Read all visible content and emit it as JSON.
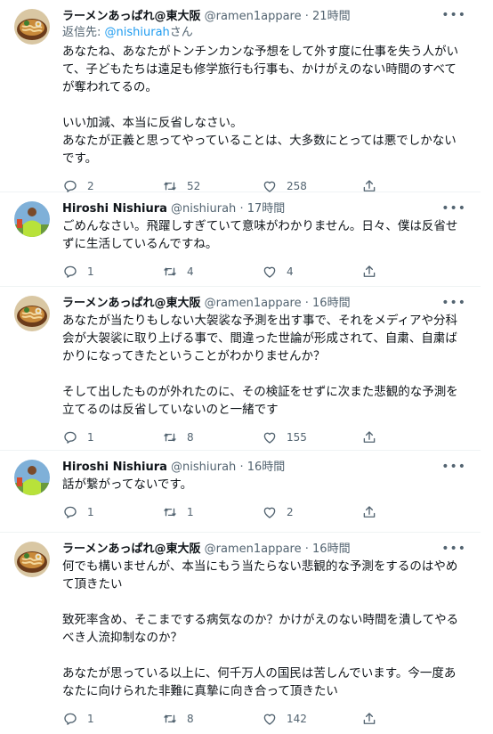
{
  "tweets": [
    {
      "name": "ラーメンあっぱれ@東大阪",
      "handle": "@ramen1appare",
      "time": "21時間",
      "reply_prefix": "返信先: ",
      "reply_handle": "@nishiurah",
      "reply_suffix": "さん",
      "text": "あなたね、あなたがトンチンカンな予想をして外す度に仕事を失う人がいて、子どもたちは遠足も修学旅行も行事も、かけがえのない時間のすべてが奪われてるの。\n\nいい加減、本当に反省しなさい。\nあなたが正義と思ってやっていることは、大多数にとっては悪でしかないです。",
      "replies": "2",
      "retweets": "52",
      "likes": "258"
    },
    {
      "name": "Hiroshi Nishiura",
      "handle": "@nishiurah",
      "time": "17時間",
      "text": "ごめんなさい。飛躍しすぎていて意味がわかりません。日々、僕は反省せずに生活しているんですね。",
      "replies": "1",
      "retweets": "4",
      "likes": "4"
    },
    {
      "name": "ラーメンあっぱれ@東大阪",
      "handle": "@ramen1appare",
      "time": "16時間",
      "text": "あなたが当たりもしない大袈裟な予測を出す事で、それをメディアや分科会が大袈裟に取り上げる事で、間違った世論が形成されて、自粛、自粛ばかりになってきたということがわかりませんか？\n\nそして出したものが外れたのに、その検証をせずに次また悲観的な予測を立てるのは反省していないのと一緒です",
      "replies": "1",
      "retweets": "8",
      "likes": "155"
    },
    {
      "name": "Hiroshi Nishiura",
      "handle": "@nishiurah",
      "time": "16時間",
      "text": "話が繋がってないです。",
      "replies": "1",
      "retweets": "1",
      "likes": "2"
    },
    {
      "name": "ラーメンあっぱれ@東大阪",
      "handle": "@ramen1appare",
      "time": "16時間",
      "text": "何でも構いませんが、本当にもう当たらない悲観的な予測をするのはやめて頂きたい\n\n致死率含め、そこまでする病気なのか？かけがえのない時間を潰してやるべき人流抑制なのか？\n\nあなたが思っている以上に、何千万人の国民は苦しんでいます。今一度あなたに向けられた非難に真摯に向き合って頂きたい",
      "replies": "1",
      "retweets": "8",
      "likes": "142"
    }
  ],
  "colors": {
    "link": "#1d9bf0",
    "muted": "#536471",
    "text": "#0f1419",
    "divider": "#eff3f4"
  },
  "icons": [
    "more-icon",
    "reply-icon",
    "retweet-icon",
    "like-icon",
    "share-icon"
  ]
}
